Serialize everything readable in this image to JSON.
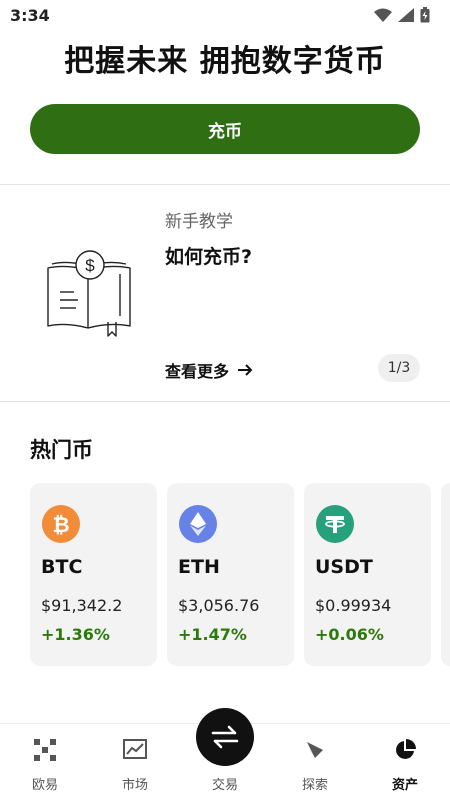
{
  "status_bar": {
    "time": "3:34"
  },
  "hero": {
    "title": "把握未来 拥抱数字货币",
    "deposit_label": "充币"
  },
  "tutorial": {
    "subtitle": "新手教学",
    "title": "如何充币?",
    "more_label": "查看更多",
    "pager": "1/3"
  },
  "hot": {
    "title": "热门币",
    "coins": [
      {
        "symbol": "BTC",
        "price": "$91,342.2",
        "change": "+1.36%",
        "color": "#f28c38"
      },
      {
        "symbol": "ETH",
        "price": "$3,056.76",
        "change": "+1.47%",
        "color": "#6782e6"
      },
      {
        "symbol": "USDT",
        "price": "$0.99934",
        "change": "+0.06%",
        "color": "#26a17b"
      }
    ]
  },
  "nav": {
    "items": [
      {
        "label": "欧易",
        "icon": "okx-logo-icon"
      },
      {
        "label": "市场",
        "icon": "chart-icon"
      },
      {
        "label": "交易",
        "icon": "swap-icon"
      },
      {
        "label": "探索",
        "icon": "compass-icon"
      },
      {
        "label": "资产",
        "icon": "pie-chart-icon"
      }
    ],
    "active_index": 4
  },
  "colors": {
    "primary": "#2f6e12",
    "positive": "#2b7a0b"
  }
}
